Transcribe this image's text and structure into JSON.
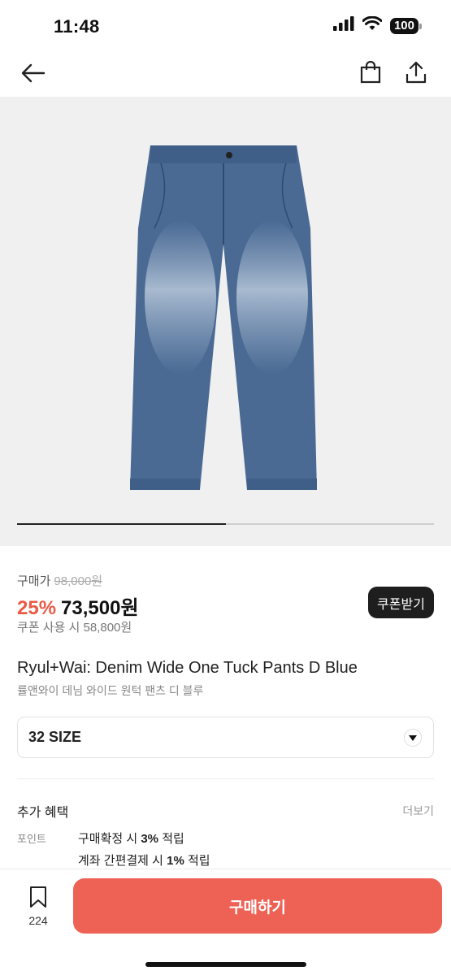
{
  "status": {
    "time": "11:48",
    "battery": "100",
    "icons": [
      "signal-icon",
      "wifi-icon",
      "battery-icon"
    ]
  },
  "nav": {
    "icons": [
      "back-arrow-icon",
      "shopping-bag-icon",
      "share-icon"
    ]
  },
  "image": {
    "icon": "jeans-product-image",
    "slide_progress": 0.5,
    "denim_color": "#4a6a94"
  },
  "price": {
    "label": "구매가",
    "original": "98,000원",
    "discount": "25%",
    "sale": "73,500원",
    "coupon_price": "쿠폰 사용 시 58,800원",
    "coupon_button": "쿠폰받기"
  },
  "product": {
    "title": "Ryul+Wai: Denim Wide One Tuck Pants D Blue",
    "subtitle": "률앤와이 데님 와이드 원턱 팬츠 디 블루"
  },
  "size": {
    "selected": "32 SIZE",
    "icon": "chevron-down-icon"
  },
  "benefits": {
    "title": "추가 혜택",
    "more": "더보기",
    "point_label": "포인트",
    "line1": {
      "prefix": "구매확정 시 ",
      "rate": "3%",
      "suffix": " 적립"
    },
    "line2": {
      "prefix": "계좌 간편결제 시 ",
      "rate": "1%",
      "suffix": " 적립"
    }
  },
  "bottom": {
    "bookmark_count": "224",
    "buy_label": "구매하기",
    "accent": "#ee6155"
  }
}
